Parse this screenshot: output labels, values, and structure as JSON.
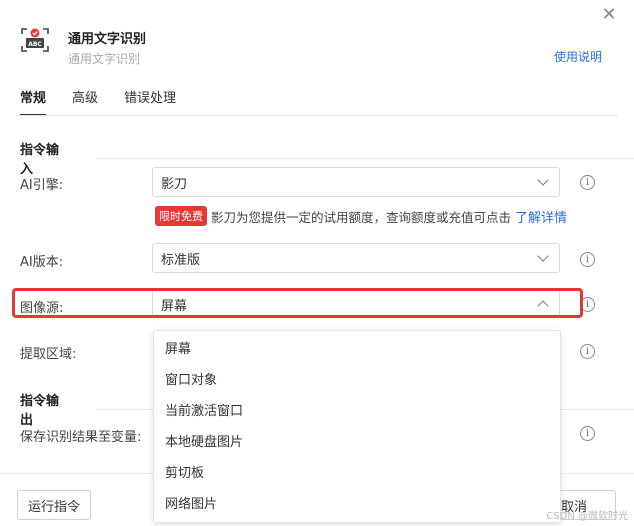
{
  "window": {
    "close_glyph": "✕"
  },
  "header": {
    "title": "通用文字识别",
    "subtitle": "通用文字识别",
    "help_link": "使用说明",
    "icon_text": "ABC",
    "accent_color": "#e53935"
  },
  "tabs": [
    {
      "label": "常规",
      "active": true
    },
    {
      "label": "高级",
      "active": false
    },
    {
      "label": "错误处理",
      "active": false
    }
  ],
  "sections": {
    "input": "指令输入",
    "output": "指令输出"
  },
  "fields": {
    "ai_engine": {
      "label": "AI引擎:",
      "value": "影刀"
    },
    "ai_version": {
      "label": "AI版本:",
      "value": "标准版"
    },
    "image_source": {
      "label": "图像源:",
      "value": "屏幕"
    },
    "region": {
      "label": "提取区域:"
    },
    "save_var": {
      "label": "保存识别结果至变量:"
    }
  },
  "promo": {
    "badge": "限时免费",
    "text": "影刀为您提供一定的试用额度，查询额度或充值可点击",
    "link": "了解详情"
  },
  "dropdown": {
    "options": [
      "屏幕",
      "窗口对象",
      "当前激活窗口",
      "本地硬盘图片",
      "剪切板",
      "网络图片"
    ]
  },
  "footer": {
    "run_button": "运行指令",
    "cancel_button": "取消"
  },
  "watermark": "CSDN @微软时光"
}
